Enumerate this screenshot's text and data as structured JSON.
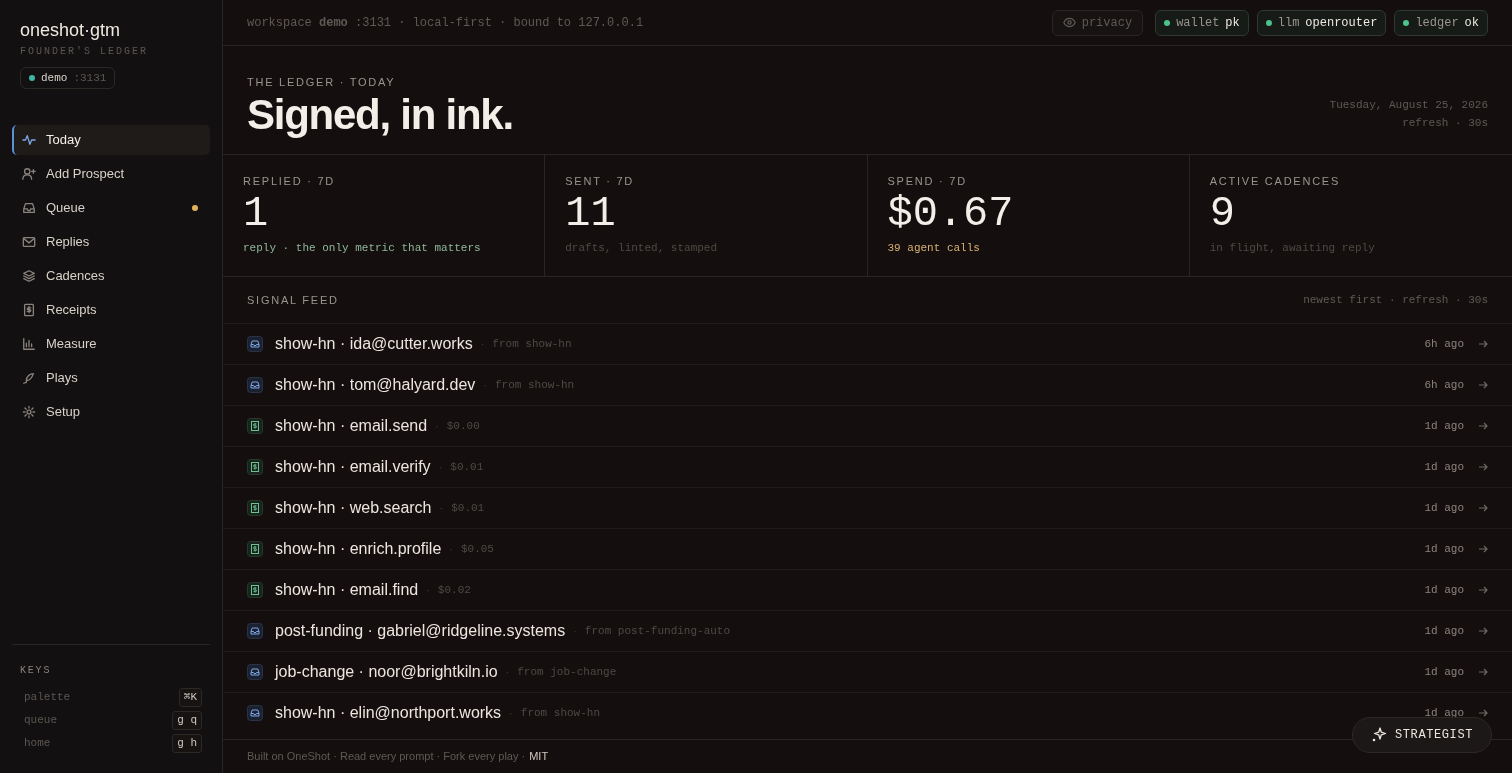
{
  "brand": {
    "name": "oneshot·gtm",
    "subtitle": "FOUNDER'S LEDGER",
    "workspace": {
      "name": "demo",
      "port": ":3131",
      "color": "#3fb6a8"
    }
  },
  "nav": [
    {
      "label": "Today",
      "selected": true
    },
    {
      "label": "Add Prospect",
      "selected": false
    },
    {
      "label": "Queue",
      "selected": false,
      "color": "#e0b25a"
    },
    {
      "label": "Replies",
      "selected": false
    },
    {
      "label": "Cadences",
      "selected": false
    },
    {
      "label": "Receipts",
      "selected": false
    },
    {
      "label": "Measure",
      "selected": false
    },
    {
      "label": "Plays",
      "selected": false
    },
    {
      "label": "Setup",
      "selected": false
    }
  ],
  "keys": {
    "title": "KEYS",
    "items": [
      {
        "action": "palette",
        "keys": "⌘K"
      },
      {
        "action": "queue",
        "keys": "g q"
      },
      {
        "action": "home",
        "keys": "g h"
      }
    ]
  },
  "topbar": {
    "context": "workspace **demo** :3131 · local-first · bound to 127.0.0.1",
    "privacy": "privacy",
    "status": [
      {
        "label": "wallet",
        "value": "pk",
        "color": "#4cc38a"
      },
      {
        "label": "llm",
        "value": "openrouter",
        "color": "#4cc38a"
      },
      {
        "label": "ledger",
        "value": "ok",
        "color": "#4cc38a"
      }
    ]
  },
  "header": {
    "eyebrow": "THE LEDGER · TODAY",
    "title": "Signed, in ink.",
    "date": "Tuesday, August 25, 2026",
    "refresh": "refresh · 30s"
  },
  "stats": [
    {
      "label": "REPLIED · 7D",
      "value": "1",
      "caption": "reply · the only metric that matters",
      "color": "#8fb89a"
    },
    {
      "label": "SENT · 7D",
      "value": "11",
      "caption": "drafts, linted, stamped",
      "color": "#4f4944"
    },
    {
      "label": "SPEND · 7D",
      "value": "$0.67",
      "caption": "39 agent calls",
      "color": "#d8b070"
    },
    {
      "label": "ACTIVE CADENCES",
      "value": "9",
      "caption": "in flight, awaiting reply",
      "color": "#4f4944"
    }
  ],
  "feed": {
    "title": "SIGNAL FEED",
    "note": "newest first · refresh · 30s",
    "items": [
      {
        "kind": "prospect",
        "title": "show-hn · ida@cutter.works",
        "sep": "·",
        "meta": "from show-hn",
        "time": "6h ago"
      },
      {
        "kind": "prospect",
        "title": "show-hn · tom@halyard.dev",
        "sep": "·",
        "meta": "from show-hn",
        "time": "6h ago"
      },
      {
        "kind": "receipt",
        "title": "show-hn · email.send",
        "sep": "·",
        "meta": "$0.00",
        "time": "1d ago"
      },
      {
        "kind": "receipt",
        "title": "show-hn · email.verify",
        "sep": "·",
        "meta": "$0.01",
        "time": "1d ago"
      },
      {
        "kind": "receipt",
        "title": "show-hn · web.search",
        "sep": "·",
        "meta": "$0.01",
        "time": "1d ago"
      },
      {
        "kind": "receipt",
        "title": "show-hn · enrich.profile",
        "sep": "·",
        "meta": "$0.05",
        "time": "1d ago"
      },
      {
        "kind": "receipt",
        "title": "show-hn · email.find",
        "sep": "·",
        "meta": "$0.02",
        "time": "1d ago"
      },
      {
        "kind": "prospect",
        "title": "post-funding · gabriel@ridgeline.systems",
        "sep": "·",
        "meta": "from post-funding-auto",
        "time": "1d ago"
      },
      {
        "kind": "prospect",
        "title": "job-change · noor@brightkiln.io",
        "sep": "·",
        "meta": "from job-change",
        "time": "1d ago"
      },
      {
        "kind": "prospect",
        "title": "show-hn · elin@northport.works",
        "sep": "·",
        "meta": "from show-hn",
        "time": "1d ago"
      }
    ]
  },
  "footer": {
    "text": "Built on OneShot · Read every prompt · Fork every play ·",
    "license": "MIT"
  },
  "assistant": {
    "label": "STRATEGIST"
  }
}
